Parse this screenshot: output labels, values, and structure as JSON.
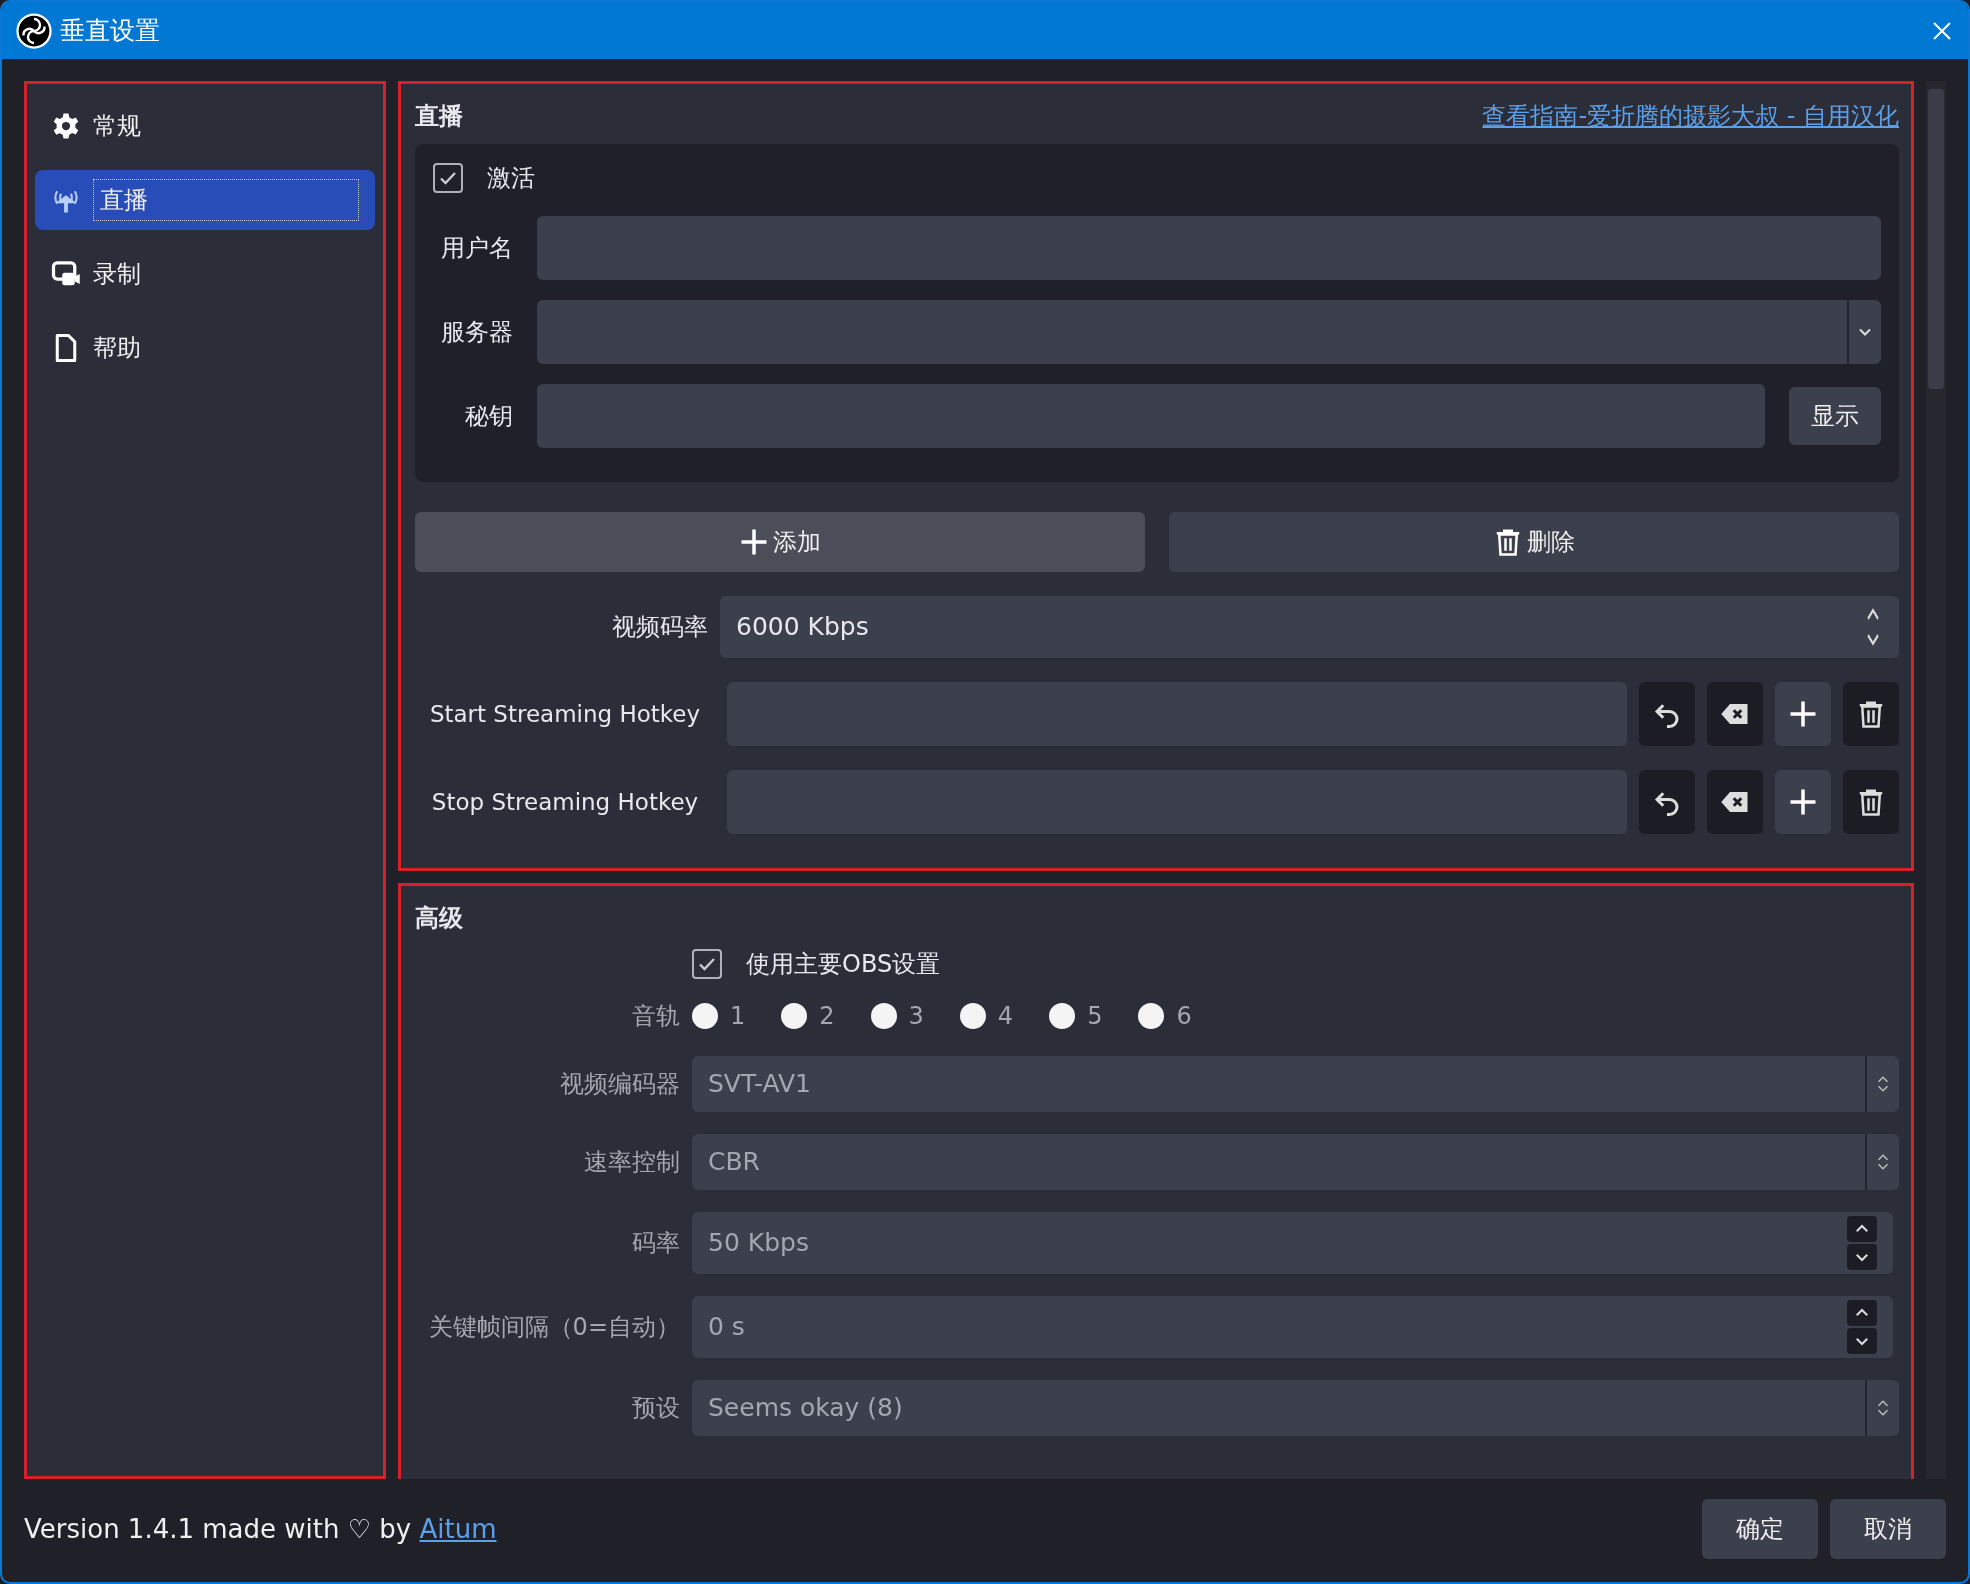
{
  "window": {
    "title": "垂直设置"
  },
  "sidebar": {
    "items": [
      {
        "label": "常规",
        "selected": false
      },
      {
        "label": "直播",
        "selected": true
      },
      {
        "label": "录制",
        "selected": false
      },
      {
        "label": "帮助",
        "selected": false
      }
    ]
  },
  "stream_section": {
    "title": "直播",
    "guide_link": "查看指南-爱折腾的摄影大叔 - 自用汉化",
    "active": {
      "label": "激活",
      "checked": true
    },
    "fields": [
      {
        "label": "用户名",
        "kind": "text"
      },
      {
        "label": "服务器",
        "kind": "dropdown"
      },
      {
        "label": "秘钥",
        "kind": "secret",
        "button": "显示"
      }
    ],
    "add_button": "添加",
    "delete_button": "删除",
    "bitrate": {
      "label": "视频码率",
      "value": "6000 Kbps"
    },
    "hotkeys": [
      {
        "label": "Start Streaming Hotkey"
      },
      {
        "label": "Stop Streaming Hotkey"
      }
    ]
  },
  "advanced_section": {
    "title": "高级",
    "use_main": {
      "label": "使用主要OBS设置",
      "checked": true
    },
    "tracks": {
      "label": "音轨",
      "disabled": true,
      "options": [
        {
          "label": "1",
          "checked": false
        },
        {
          "label": "2",
          "checked": false
        },
        {
          "label": "3",
          "checked": false
        },
        {
          "label": "4",
          "checked": false
        },
        {
          "label": "5",
          "checked": false
        },
        {
          "label": "6",
          "checked": false
        }
      ]
    },
    "fields": [
      {
        "label": "视频编码器",
        "kind": "combo",
        "value": "SVT-AV1",
        "disabled": true
      },
      {
        "label": "速率控制",
        "kind": "combo",
        "value": "CBR",
        "disabled": true
      },
      {
        "label": "码率",
        "kind": "spin",
        "value": "50 Kbps",
        "disabled": true
      },
      {
        "label": "关键帧间隔（0=自动）",
        "kind": "spin",
        "value": "0 s",
        "disabled": true
      },
      {
        "label": "预设",
        "kind": "combo",
        "value": "Seems okay (8)",
        "disabled": true
      }
    ]
  },
  "footer": {
    "version_text": "Version 1.4.1 made with ♡ by",
    "link": "Aitum",
    "ok_button": "确定",
    "cancel_button": "取消"
  }
}
